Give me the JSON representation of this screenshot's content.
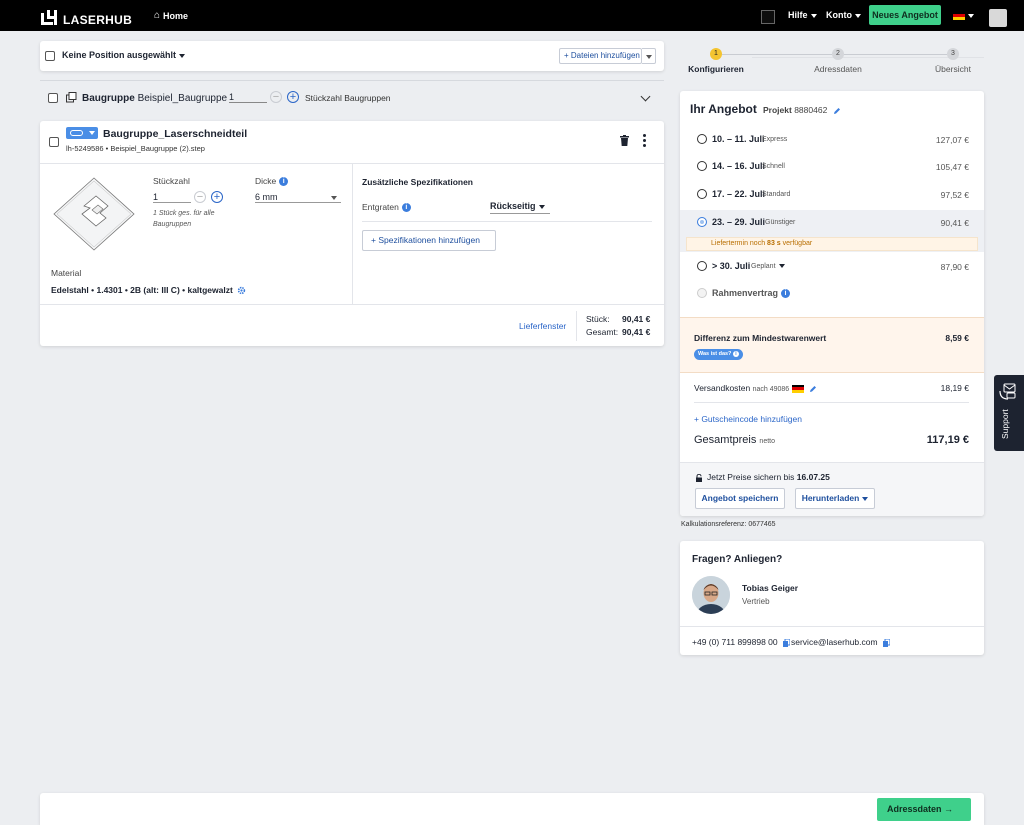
{
  "header": {
    "brand": "LASERHUB",
    "home": "Home",
    "menu_help": "Hilfe",
    "menu_account": "Konto",
    "new_offer": "Neues Angebot",
    "accent": "#3fd08b"
  },
  "selection": {
    "label": "Keine Position ausgewählt",
    "add_files": "+ Dateien hinzufügen"
  },
  "group": {
    "label_bold": "Baugruppe",
    "label_name": "Beispiel_Baugruppe",
    "qty": "1",
    "qty_caption": "Stückzahl Baugruppen"
  },
  "part": {
    "title": "Baugruppe_Laserschneidteil",
    "sub": "lh-5249586  •  Beispiel_Baugruppe (2).step",
    "qty_label": "Stückzahl",
    "qty_value": "1",
    "qty_hint_1": "1 Stück ges. für alle",
    "qty_hint_2": "Baugruppen",
    "thickness_label": "Dicke",
    "thickness_value": "6 mm",
    "material_label": "Material",
    "material_value": "Edelstahl • 1.4301 • 2B (alt: III C) • kaltgewalzt",
    "spec_title": "Zusätzliche Spezifikationen",
    "deburr_label": "Entgraten",
    "deburr_value": "Rückseitig",
    "add_spec": "+  Spezifikationen hinzufügen",
    "delivery_link": "Lieferfenster",
    "unit_label": "Stück:",
    "unit_price": "90,41 €",
    "total_label": "Gesamt:",
    "total_price": "90,41 €"
  },
  "stepper": {
    "steps": [
      {
        "num": "1",
        "label": "Konfigurieren"
      },
      {
        "num": "2",
        "label": "Adressdaten"
      },
      {
        "num": "3",
        "label": "Übersicht"
      }
    ],
    "active_color": "#f4c430"
  },
  "offer": {
    "title": "Ihr Angebot",
    "project_label": "Projekt",
    "project_no": "8880462",
    "options": [
      {
        "date": "10. – 11. Juli",
        "kind": "Express",
        "price": "127,07 €"
      },
      {
        "date": "14. – 16. Juli",
        "kind": "Schnell",
        "price": "105,47 €"
      },
      {
        "date": "17. – 22. Juli",
        "kind": "Standard",
        "price": "97,52 €"
      },
      {
        "date": "23. – 29. Juli",
        "kind": "Günstiger",
        "price": "90,41 €"
      },
      {
        "date": "> 30. Juli",
        "kind": "Geplant",
        "price": "87,90 €"
      }
    ],
    "notice_prefix": "Liefertermin noch",
    "notice_secs": "83 s",
    "notice_suffix": "verfügbar",
    "frame_contract": "Rahmenvertrag",
    "diff_title": "Differenz zum Mindestwarenwert",
    "diff_value": "8,59 €",
    "what_is_that": "Was ist das?",
    "shipping_label": "Versandkosten",
    "shipping_sub": "nach 49086",
    "shipping_value": "18,19 €",
    "voucher": "+ Gutscheincode hinzufügen",
    "total_label": "Gesamtpreis",
    "total_sub": "netto",
    "total_value": "117,19 €",
    "lock_text": "Jetzt Preise sichern bis",
    "lock_date": "16.07.25",
    "save_btn": "Angebot speichern",
    "download_btn": "Herunterladen"
  },
  "calc_ref": "Kalkulationsreferenz: 0677465",
  "contact": {
    "title": "Fragen? Anliegen?",
    "name": "Tobias Geiger",
    "role": "Vertrieb",
    "phone": "+49 (0) 711 899898 00",
    "email": "service@laserhub.com"
  },
  "support": "Support",
  "footer": {
    "next": "Adressdaten  →"
  }
}
